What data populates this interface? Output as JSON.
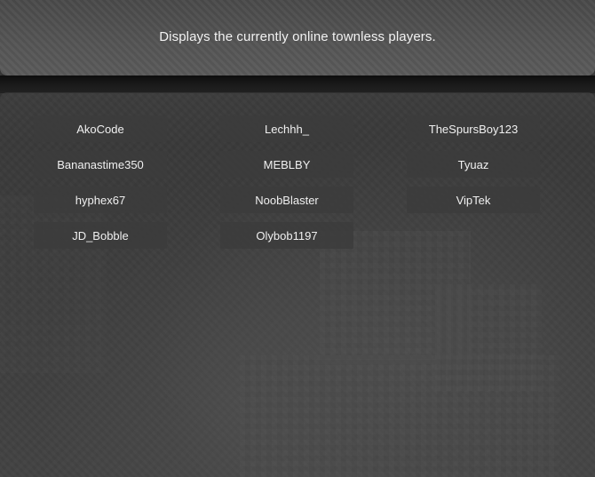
{
  "header": {
    "description": "Displays the currently online townless players."
  },
  "players": [
    "AkoCode",
    "Lechhh_",
    "TheSpursBoy123",
    "Bananastime350",
    "MEBLBY",
    "Tyuaz",
    "hyphex67",
    "NoobBlaster",
    "VipTek",
    "JD_Bobble",
    "Olybob1197"
  ]
}
